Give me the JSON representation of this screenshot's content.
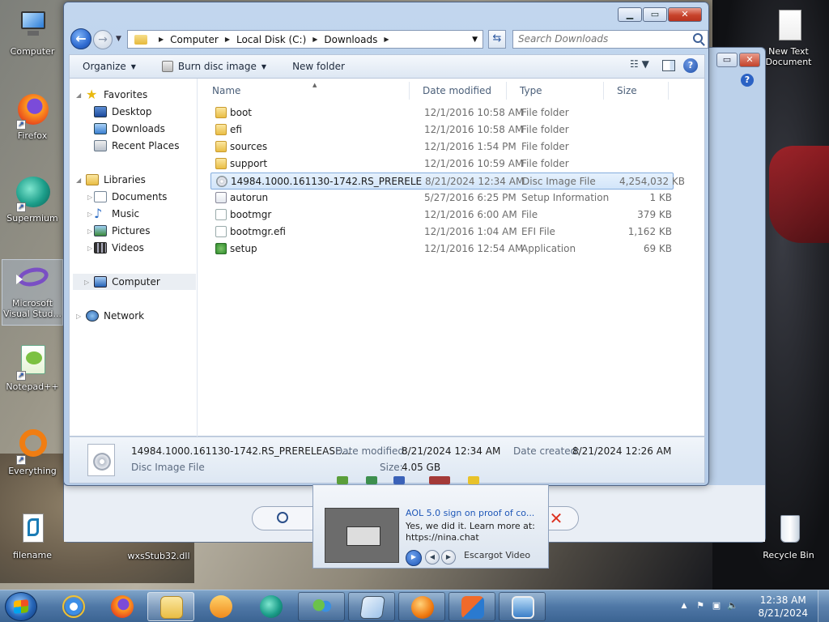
{
  "desktop": {
    "icons_left": [
      {
        "label": "Computer",
        "icon": "computer-icon"
      },
      {
        "label": "Firefox",
        "icon": "firefox-icon"
      },
      {
        "label": "Supermium",
        "icon": "supermium-icon"
      },
      {
        "label": "Microsoft Visual Stud...",
        "icon": "visual-studio-icon"
      },
      {
        "label": "Notepad++",
        "icon": "notepadpp-icon"
      },
      {
        "label": "Everything",
        "icon": "everything-icon"
      },
      {
        "label": "filename",
        "icon": "script-icon"
      }
    ],
    "icons_right": [
      {
        "label": "New Text Document",
        "icon": "text-document-icon"
      },
      {
        "label": "Recycle Bin",
        "icon": "recycle-bin-icon"
      }
    ],
    "partial_label": "wxsStub32.dll"
  },
  "explorer": {
    "address": {
      "crumbs": [
        "Computer",
        "Local Disk (C:)",
        "Downloads"
      ]
    },
    "search": {
      "placeholder": "Search Downloads"
    },
    "commands": {
      "organize": "Organize",
      "burn": "Burn disc image",
      "new_folder": "New folder"
    },
    "navpane": {
      "favorites": "Favorites",
      "desktop": "Desktop",
      "downloads": "Downloads",
      "recent": "Recent Places",
      "libraries": "Libraries",
      "documents": "Documents",
      "music": "Music",
      "pictures": "Pictures",
      "videos": "Videos",
      "computer": "Computer",
      "network": "Network"
    },
    "columns": {
      "name": "Name",
      "date": "Date modified",
      "type": "Type",
      "size": "Size"
    },
    "files": [
      {
        "name": "boot",
        "date": "12/1/2016 10:58 AM",
        "type": "File folder",
        "size": "",
        "icon": "folder"
      },
      {
        "name": "efi",
        "date": "12/1/2016 10:58 AM",
        "type": "File folder",
        "size": "",
        "icon": "folder"
      },
      {
        "name": "sources",
        "date": "12/1/2016 1:54 PM",
        "type": "File folder",
        "size": "",
        "icon": "folder"
      },
      {
        "name": "support",
        "date": "12/1/2016 10:59 AM",
        "type": "File folder",
        "size": "",
        "icon": "folder"
      },
      {
        "name": "14984.1000.161130-1742.RS_PRERELEASE_...",
        "date": "8/21/2024 12:34 AM",
        "type": "Disc Image File",
        "size": "4,254,032 KB",
        "icon": "disc",
        "selected": true
      },
      {
        "name": "autorun",
        "date": "5/27/2016 6:25 PM",
        "type": "Setup Information",
        "size": "1 KB",
        "icon": "setupinfo"
      },
      {
        "name": "bootmgr",
        "date": "12/1/2016 6:00 AM",
        "type": "File",
        "size": "379 KB",
        "icon": "file"
      },
      {
        "name": "bootmgr.efi",
        "date": "12/1/2016 1:04 AM",
        "type": "EFI File",
        "size": "1,162 KB",
        "icon": "file"
      },
      {
        "name": "setup",
        "date": "12/1/2016 12:54 AM",
        "type": "Application",
        "size": "69 KB",
        "icon": "app"
      }
    ],
    "details": {
      "name": "14984.1000.161130-1742.RS_PRERELEASE...",
      "type": "Disc Image File",
      "modified_label": "Date modified:",
      "modified_value": "8/21/2024 12:34 AM",
      "created_label": "Date created:",
      "created_value": "8/21/2024 12:26 AM",
      "size_label": "Size:",
      "size_value": "4.05 GB"
    }
  },
  "notification": {
    "title": "AOL 5.0 sign on proof of co...",
    "line1": "Yes, we did it. Learn more at:",
    "line2": "https://nina.chat",
    "source": "Escargot Video"
  },
  "taskbar": {
    "time": "12:38 AM",
    "date": "8/21/2024"
  }
}
